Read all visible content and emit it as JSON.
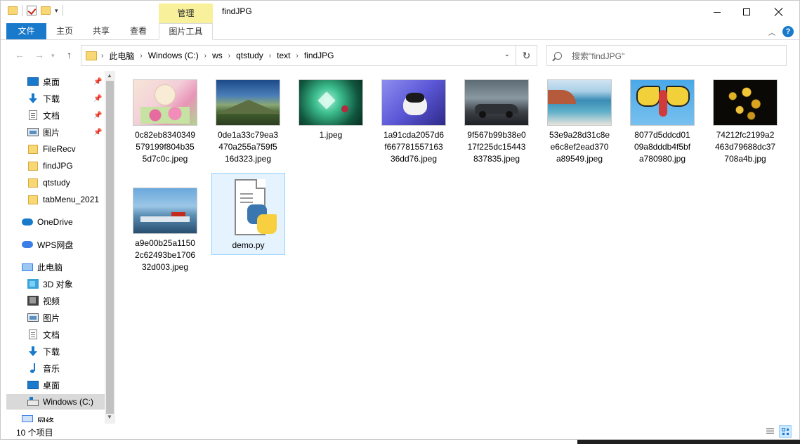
{
  "window": {
    "title": "findJPG",
    "context_tab_group": "管理"
  },
  "ribbon": {
    "tabs": [
      "文件",
      "主页",
      "共享",
      "查看",
      "图片工具"
    ]
  },
  "address": {
    "crumbs": [
      "此电脑",
      "Windows (C:)",
      "ws",
      "qtstudy",
      "text",
      "findJPG"
    ],
    "search_placeholder": "搜索\"findJPG\""
  },
  "nav": {
    "items": [
      {
        "label": "桌面",
        "icon": "desktop-icon",
        "pinned": true
      },
      {
        "label": "下载",
        "icon": "download-icon",
        "pinned": true
      },
      {
        "label": "文档",
        "icon": "document-icon",
        "pinned": true
      },
      {
        "label": "图片",
        "icon": "pictures-icon",
        "pinned": true
      },
      {
        "label": "FileRecv",
        "icon": "folder-icon",
        "pinned": false
      },
      {
        "label": "findJPG",
        "icon": "folder-icon",
        "pinned": false
      },
      {
        "label": "qtstudy",
        "icon": "folder-icon",
        "pinned": false
      },
      {
        "label": "tabMenu_2021",
        "icon": "folder-icon",
        "pinned": false
      },
      {
        "label": "OneDrive",
        "icon": "onedrive-icon",
        "pinned": false
      },
      {
        "label": "WPS网盘",
        "icon": "wps-cloud-icon",
        "pinned": false
      },
      {
        "label": "此电脑",
        "icon": "this-pc-icon",
        "pinned": false
      },
      {
        "label": "3D 对象",
        "icon": "3d-objects-icon",
        "pinned": false
      },
      {
        "label": "视频",
        "icon": "video-icon",
        "pinned": false
      },
      {
        "label": "图片",
        "icon": "pictures-icon",
        "pinned": false
      },
      {
        "label": "文档",
        "icon": "document-icon",
        "pinned": false
      },
      {
        "label": "下载",
        "icon": "download-icon",
        "pinned": false
      },
      {
        "label": "音乐",
        "icon": "music-icon",
        "pinned": false
      },
      {
        "label": "桌面",
        "icon": "desktop-icon",
        "pinned": false
      },
      {
        "label": "Windows (C:)",
        "icon": "drive-icon",
        "pinned": false,
        "selected": true
      },
      {
        "label": "网络",
        "icon": "network-icon",
        "pinned": false
      }
    ]
  },
  "files": [
    {
      "name": "0c82eb8340349579199f804b355d7c0c.jpeg",
      "lines": [
        "0c82eb8340349",
        "579199f804b35",
        "5d7c0c.jpeg"
      ],
      "thumb": "anime-girl-flowers"
    },
    {
      "name": "0de1a33c79ea3470a255a759f516d323.jpeg",
      "lines": [
        "0de1a33c79ea3",
        "470a255a759f5",
        "16d323.jpeg"
      ],
      "thumb": "mountain-valley"
    },
    {
      "name": "1.jpeg",
      "lines": [
        "1.jpeg"
      ],
      "thumb": "green-gems"
    },
    {
      "name": "1a91cda2057d6f66778155716336dd76.jpeg",
      "lines": [
        "1a91cda2057d6",
        "f667781557163",
        "36dd76.jpeg"
      ],
      "thumb": "kitten-purple"
    },
    {
      "name": "9f567b99b38e017f225dc15443837835.jpeg",
      "lines": [
        "9f567b99b38e0",
        "17f225dc15443",
        "837835.jpeg"
      ],
      "thumb": "sports-car"
    },
    {
      "name": "53e9a28d31c8ee6c8ef2ead370a89549.jpeg",
      "lines": [
        "53e9a28d31c8e",
        "e6c8ef2ead370",
        "a89549.jpeg"
      ],
      "thumb": "seashore"
    },
    {
      "name": "8077d5ddcd0109a8dddb4f5bfa780980.jpg",
      "lines": [
        "8077d5ddcd01",
        "09a8dddb4f5bf",
        "a780980.jpg"
      ],
      "thumb": "butterfly"
    },
    {
      "name": "74212fc2199a2463d79688dc37708a4b.jpg",
      "lines": [
        "74212fc2199a2",
        "463d79688dc37",
        "708a4b.jpg"
      ],
      "thumb": "yellow-flowers"
    },
    {
      "name": "a9e00b25a11502c62493be170632d003.jpeg",
      "lines": [
        "a9e00b25a1150",
        "2c62493be1706",
        "32d003.jpeg"
      ],
      "thumb": "harbor-boats"
    },
    {
      "name": "demo.py",
      "lines": [
        "demo.py"
      ],
      "thumb": "python-file",
      "selected": true
    }
  ],
  "status": {
    "count_text": "10 个项目"
  },
  "colors": {
    "accent": "#1979ca",
    "context_tab": "#f8f09a",
    "selection": "#cce8ff"
  }
}
